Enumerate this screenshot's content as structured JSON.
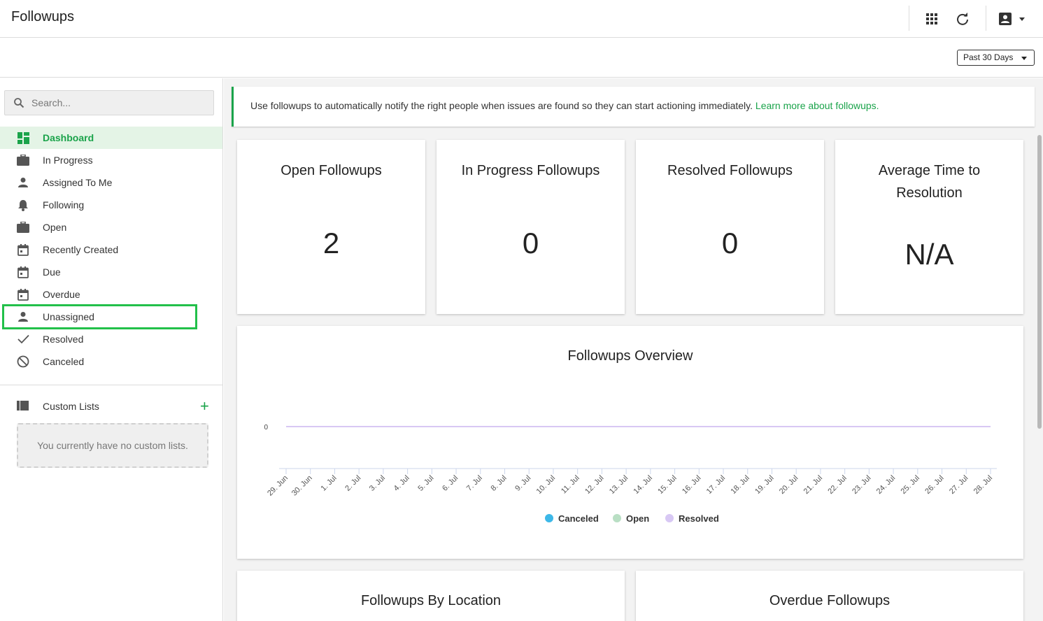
{
  "header": {
    "title": "Followups",
    "icons": [
      "apps-grid-icon",
      "refresh-icon",
      "account-icon"
    ]
  },
  "filter": {
    "date_range": "Past 30 Days"
  },
  "sidebar": {
    "search_placeholder": "Search...",
    "items": [
      {
        "label": "Dashboard",
        "icon": "dashboard-icon",
        "active": true
      },
      {
        "label": "In Progress",
        "icon": "briefcase-icon"
      },
      {
        "label": "Assigned To Me",
        "icon": "person-icon"
      },
      {
        "label": "Following",
        "icon": "bell-icon"
      },
      {
        "label": "Open",
        "icon": "briefcase-icon"
      },
      {
        "label": "Recently Created",
        "icon": "calendar-icon"
      },
      {
        "label": "Due",
        "icon": "calendar-icon"
      },
      {
        "label": "Overdue",
        "icon": "calendar-icon"
      },
      {
        "label": "Unassigned",
        "icon": "person-icon",
        "highlighted": true
      },
      {
        "label": "Resolved",
        "icon": "check-icon"
      },
      {
        "label": "Canceled",
        "icon": "block-icon"
      }
    ],
    "custom_lists": {
      "label": "Custom Lists",
      "add_label": "+",
      "empty_text": "You currently have no custom lists."
    }
  },
  "banner": {
    "text": "Use followups to automatically notify the right people when issues are found so they can start actioning immediately. ",
    "link": "Learn more about followups."
  },
  "stats": [
    {
      "title": "Open Followups",
      "value": "2"
    },
    {
      "title": "In Progress Followups",
      "value": "0"
    },
    {
      "title": "Resolved Followups",
      "value": "0"
    },
    {
      "title": "Average Time to Resolution",
      "value": "N/A"
    }
  ],
  "overview": {
    "title": "Followups Overview"
  },
  "bottom_cards": [
    {
      "title": "Followups By Location"
    },
    {
      "title": "Overdue Followups"
    }
  ],
  "colors": {
    "accent": "#1aa34a",
    "canceled": "#3db8e8",
    "open": "#b9dfc4",
    "resolved": "#d8c8f4"
  },
  "chart_data": {
    "type": "line",
    "title": "Followups Overview",
    "x": [
      "29. Jun",
      "30. Jun",
      "1. Jul",
      "2. Jul",
      "3. Jul",
      "4. Jul",
      "5. Jul",
      "6. Jul",
      "7. Jul",
      "8. Jul",
      "9. Jul",
      "10. Jul",
      "11. Jul",
      "12. Jul",
      "13. Jul",
      "14. Jul",
      "15. Jul",
      "16. Jul",
      "17. Jul",
      "18. Jul",
      "19. Jul",
      "20. Jul",
      "21. Jul",
      "22. Jul",
      "23. Jul",
      "24. Jul",
      "25. Jul",
      "26. Jul",
      "27. Jul",
      "28. Jul"
    ],
    "y_ticks": [
      "0"
    ],
    "series": [
      {
        "name": "Canceled",
        "color": "#3db8e8",
        "values": [
          0,
          0,
          0,
          0,
          0,
          0,
          0,
          0,
          0,
          0,
          0,
          0,
          0,
          0,
          0,
          0,
          0,
          0,
          0,
          0,
          0,
          0,
          0,
          0,
          0,
          0,
          0,
          0,
          0,
          0
        ]
      },
      {
        "name": "Open",
        "color": "#b9dfc4",
        "values": [
          0,
          0,
          0,
          0,
          0,
          0,
          0,
          0,
          0,
          0,
          0,
          0,
          0,
          0,
          0,
          0,
          0,
          0,
          0,
          0,
          0,
          0,
          0,
          0,
          0,
          0,
          0,
          0,
          0,
          0
        ]
      },
      {
        "name": "Resolved",
        "color": "#d8c8f4",
        "values": [
          0,
          0,
          0,
          0,
          0,
          0,
          0,
          0,
          0,
          0,
          0,
          0,
          0,
          0,
          0,
          0,
          0,
          0,
          0,
          0,
          0,
          0,
          0,
          0,
          0,
          0,
          0,
          0,
          0,
          0
        ]
      }
    ],
    "legend": "bottom-center",
    "grid": false
  }
}
